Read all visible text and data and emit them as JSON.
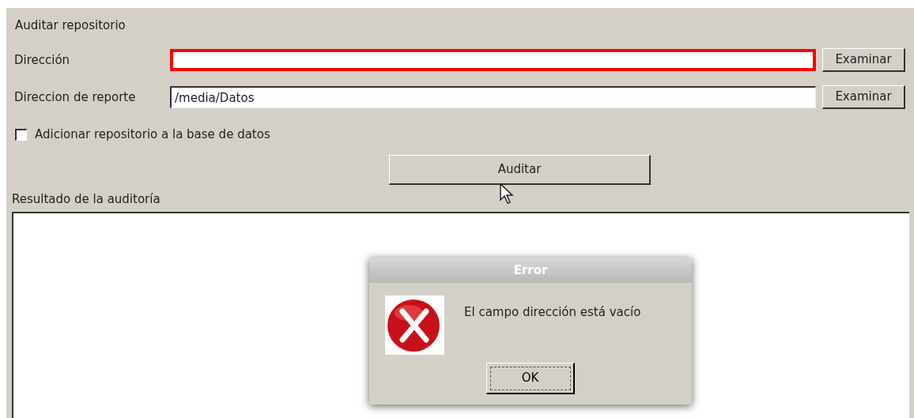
{
  "panel": {
    "title": "Auditar repositorio"
  },
  "fields": [
    {
      "label": "Dirección",
      "invalid": true,
      "button": "Examinar"
    },
    {
      "label": "Direccion de reporte",
      "value": "/media/Datos",
      "invalid": false,
      "button": "Examinar"
    }
  ],
  "checkbox": {
    "label": "Adicionar repositorio a la base de datos",
    "checked": false
  },
  "audit_button": "Auditar",
  "results": {
    "label": "Resultado de la auditoría"
  },
  "dialog": {
    "title": "Error",
    "message": "El campo dirección está vacío",
    "button": "OK"
  }
}
